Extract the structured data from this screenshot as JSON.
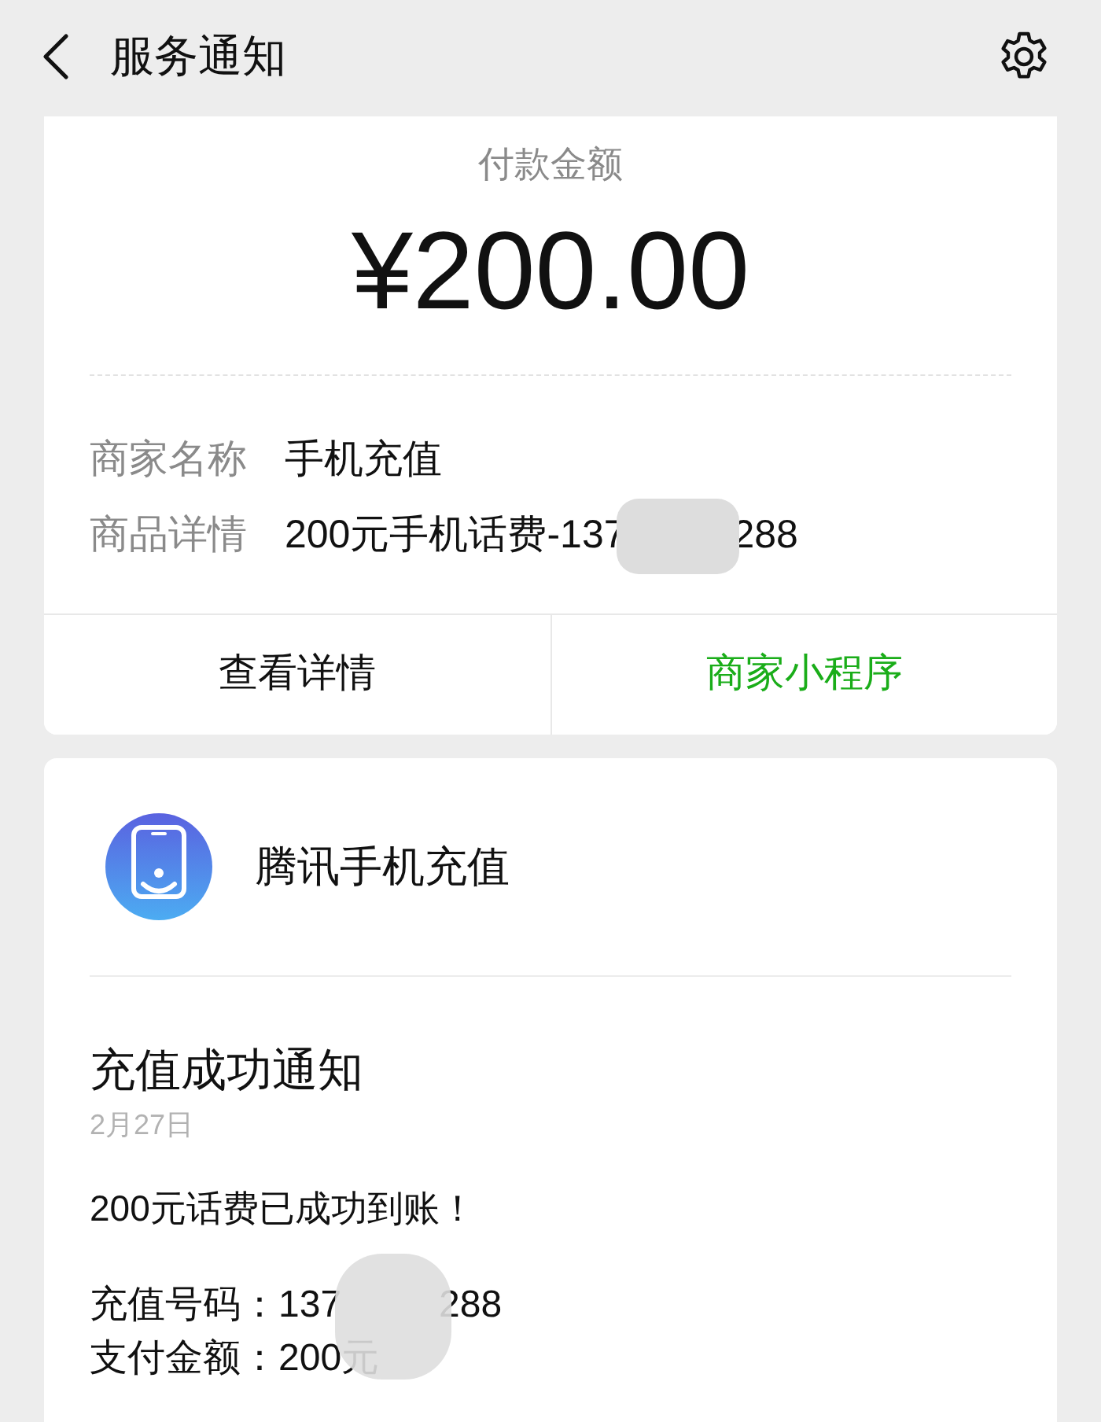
{
  "header": {
    "title": "服务通知"
  },
  "payment_card": {
    "amount_label": "付款金额",
    "amount": "¥200.00",
    "details": [
      {
        "label": "商家名称",
        "value": "手机充值",
        "redacted": false
      },
      {
        "label": "商品详情",
        "value": "200元手机话费-137",
        "value_after": "288",
        "redacted": true
      }
    ],
    "actions": [
      {
        "label": "查看详情",
        "kind": "plain"
      },
      {
        "label": "商家小程序",
        "kind": "link"
      }
    ]
  },
  "notice_card": {
    "service_name": "腾讯手机充值",
    "title": "充值成功通知",
    "date": "2月27日",
    "message": "200元话费已成功到账！",
    "details": [
      {
        "label": "充值号码：",
        "value": "137",
        "value_after": "288",
        "redacted": true
      },
      {
        "label": "支付金额：",
        "value": "200元",
        "redacted": false
      }
    ]
  }
}
